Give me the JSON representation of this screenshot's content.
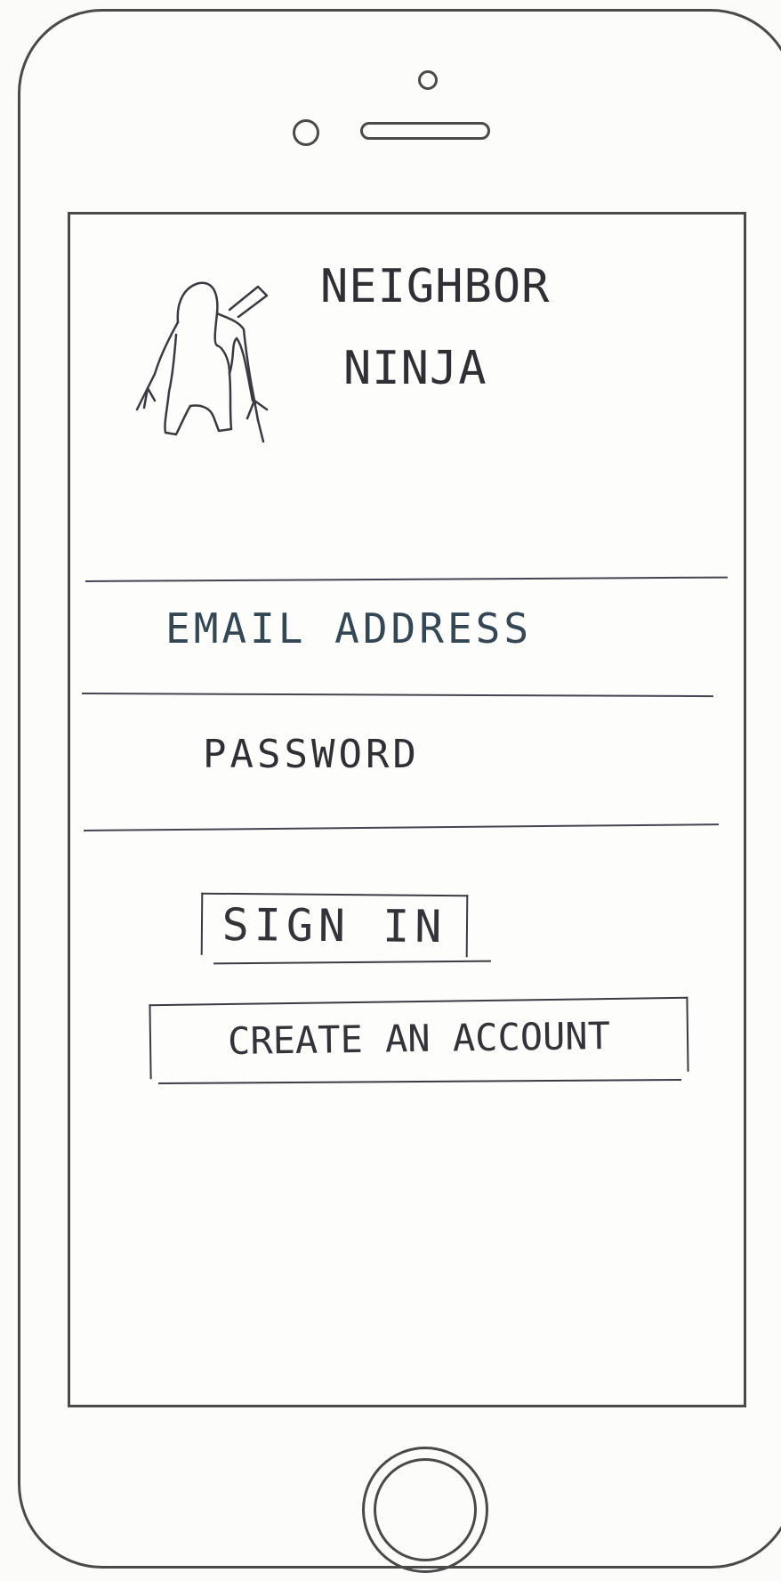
{
  "app": {
    "title_line1": "NEIGHBOR",
    "title_line2": "NINJA"
  },
  "login_form": {
    "email_placeholder": "EMAIL ADDRESS",
    "password_placeholder": "PASSWORD",
    "sign_in_label": "SIGN IN",
    "create_account_label": "CREATE AN ACCOUNT"
  },
  "icons": {
    "logo": "ninja-icon"
  },
  "colors": {
    "ink": "#3b3b44",
    "email_ink": "#344756",
    "phone_outline": "#4a4a4a",
    "paper": "#fbfbf9"
  }
}
